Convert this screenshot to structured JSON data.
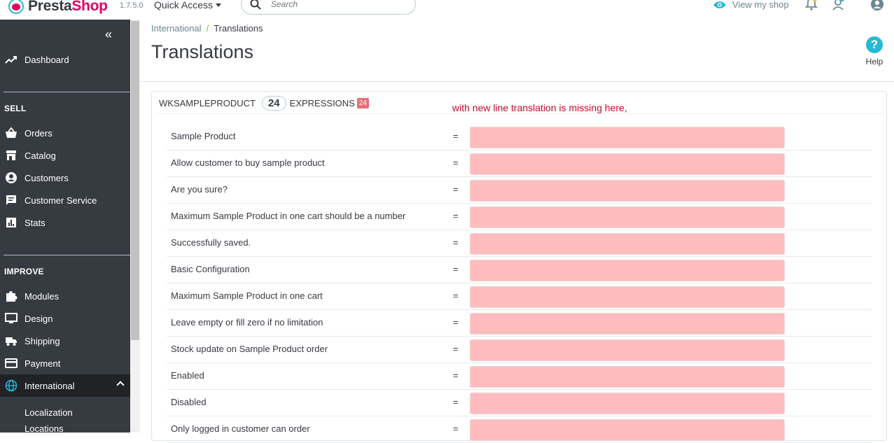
{
  "header": {
    "logo_text_a": "Presta",
    "logo_text_b": "Shop",
    "version": "1.7.5.0",
    "quick_access": "Quick Access",
    "search_placeholder": "Search",
    "view_shop": "View my shop",
    "icons": [
      "notifications-icon",
      "employee-icon",
      "user-account-icon"
    ]
  },
  "sidebar": {
    "dashboard": "Dashboard",
    "sell_title": "SELL",
    "sell_items": [
      "Orders",
      "Catalog",
      "Customers",
      "Customer Service",
      "Stats"
    ],
    "improve_title": "IMPROVE",
    "improve_items": [
      "Modules",
      "Design",
      "Shipping",
      "Payment",
      "International"
    ],
    "sub_items": [
      "Localization",
      "Locations"
    ]
  },
  "breadcrumb": {
    "parent": "International",
    "separator": "/",
    "current": "Translations"
  },
  "page": {
    "title": "Translations",
    "help_label": "Help"
  },
  "panel": {
    "module_name": "WKSAMPLEPRODUCT",
    "count": "24",
    "expressions_label": "EXPRESSIONS",
    "missing_badge": "24",
    "annotation": "with new line translation is missing here,",
    "equals": "=",
    "rows": [
      "Sample Product",
      "Allow customer to buy sample product",
      "Are you sure?",
      "Maximum Sample Product in one cart should be a number",
      "Successfully saved.",
      "Basic Configuration",
      "Maximum Sample Product in one cart",
      "Leave empty or fill zero if no limitation",
      "Stock update on Sample Product order",
      "Enabled",
      "Disabled",
      "Only logged in customer can order"
    ]
  },
  "colors": {
    "sidebar_bg": "#363a41",
    "accent": "#25b9d7",
    "brand_pink": "#df0067",
    "missing_field": "#ffbcbe",
    "annotation": "#c40a2c"
  }
}
